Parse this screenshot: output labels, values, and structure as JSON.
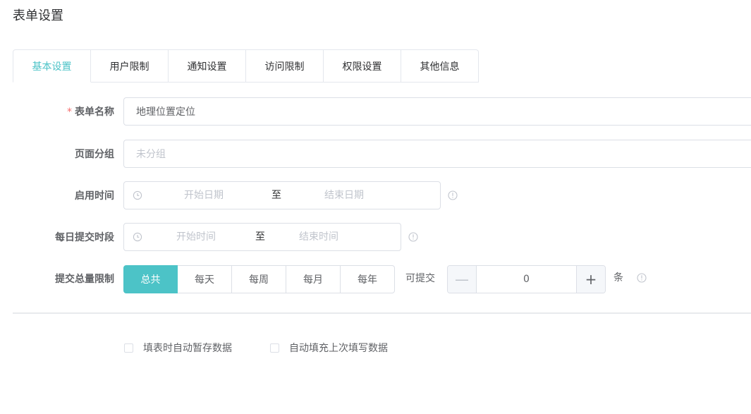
{
  "page": {
    "title": "表单设置"
  },
  "tabs": [
    {
      "label": "基本设置",
      "active": true
    },
    {
      "label": "用户限制",
      "active": false
    },
    {
      "label": "通知设置",
      "active": false
    },
    {
      "label": "访问限制",
      "active": false
    },
    {
      "label": "权限设置",
      "active": false
    },
    {
      "label": "其他信息",
      "active": false
    }
  ],
  "form": {
    "name": {
      "required_mark": "*",
      "label": "表单名称",
      "value": "地理位置定位"
    },
    "group": {
      "label": "页面分组",
      "placeholder": "未分组"
    },
    "enable_time": {
      "label": "启用时间",
      "start_placeholder": "开始日期",
      "separator": "至",
      "end_placeholder": "结束日期"
    },
    "daily_time": {
      "label": "每日提交时段",
      "start_placeholder": "开始时间",
      "separator": "至",
      "end_placeholder": "结束时间"
    },
    "submit_limit": {
      "label": "提交总量限制",
      "options": [
        {
          "label": "总共",
          "active": true
        },
        {
          "label": "每天",
          "active": false
        },
        {
          "label": "每周",
          "active": false
        },
        {
          "label": "每月",
          "active": false
        },
        {
          "label": "每年",
          "active": false
        }
      ],
      "prefix": "可提交",
      "count": "0",
      "minus": "—",
      "plus": "+",
      "suffix": "条"
    }
  },
  "options": {
    "autosave_label": "填表时自动暂存数据",
    "autofill_label": "自动填充上次填写数据"
  },
  "colors": {
    "accent": "#4cc3c7",
    "required": "#f56c6c",
    "border": "#dcdfe6"
  }
}
